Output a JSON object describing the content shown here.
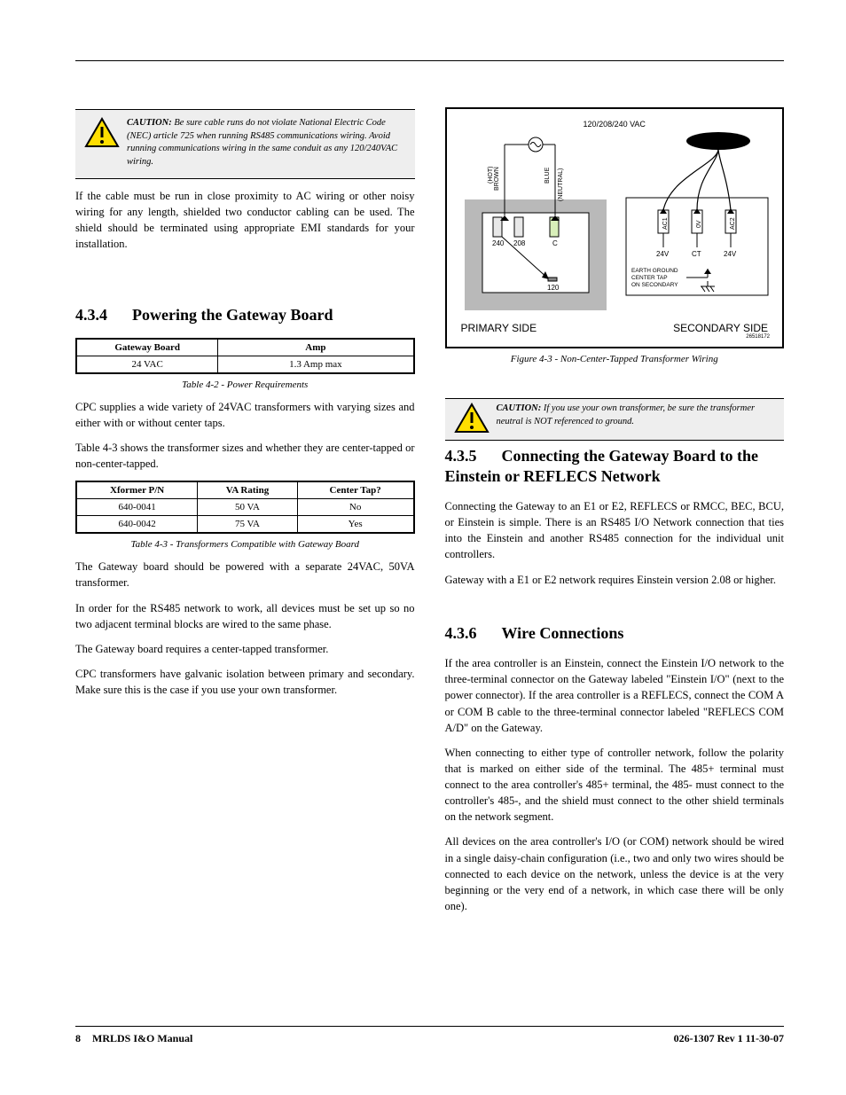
{
  "caution_left": {
    "lead": "CAUTION:",
    "text": "Be sure cable runs do not violate National Electric Code (NEC) article 725 when running RS485 communications wiring. Avoid running communications wiring in the same conduit as any 120/240VAC wiring."
  },
  "p_left_1": "If the cable must be run in close proximity to AC wiring or other noisy wiring for any length, shielded two conductor cabling can be used. The shield should be terminated using appropriate EMI standards for your installation.",
  "h_434": {
    "num": "4.3.4",
    "title": "Powering the Gateway Board"
  },
  "table42": {
    "headers": [
      "Gateway Board",
      "Amp"
    ],
    "rows": [
      [
        "24 VAC",
        "1.3 Amp max"
      ]
    ],
    "caption": "Table 4-2 - Power Requirements"
  },
  "p_left_2": "CPC supplies a wide variety of 24VAC transformers with varying sizes and either with or without center taps.",
  "p_left_3": "Table 4-3 shows the transformer sizes and whether they are center-tapped or non-center-tapped.",
  "table43": {
    "headers": [
      "Xformer P/N",
      "VA Rating",
      "Center Tap?"
    ],
    "rows": [
      [
        "640-0041",
        "50 VA",
        "No"
      ],
      [
        "640-0042",
        "75 VA",
        "Yes"
      ]
    ],
    "caption": "Table 4-3 - Transformers Compatible with Gateway Board"
  },
  "p_left_4": "The Gateway board should be powered with a separate 24VAC, 50VA transformer.",
  "p_left_5": "In order for the RS485 network to work, all devices must be set up so no two adjacent terminal blocks are wired to the same phase.",
  "p_left_6": "The Gateway board requires a center-tapped transformer.",
  "p_left_7": "CPC transformers have galvanic isolation between primary and secondary. Make sure this is the case if you use your own transformer.",
  "fig43": {
    "top_label": "120/208/240 VAC",
    "primary_wires": {
      "brown": "BROWN\n(HOT)",
      "blue": "BLUE\n(NEUTRAL)"
    },
    "primary_terms": [
      "240",
      "208",
      "C",
      "120"
    ],
    "secondary_terms": [
      "AC1",
      "0V",
      "AC2"
    ],
    "secondary_bottom": [
      "24V",
      "CT",
      "24V"
    ],
    "earth_note": "EARTH GROUND\nCENTER TAP\nON SECONDARY",
    "left_caption": "PRIMARY SIDE",
    "right_caption": "SECONDARY SIDE",
    "partno": "26518172",
    "caption": "Figure 4-3  - Non-Center-Tapped Transformer Wiring"
  },
  "caution_right": {
    "lead": "CAUTION:",
    "text": "If you use your own transformer, be sure the transformer neutral is NOT referenced to ground."
  },
  "h_435": {
    "num": "4.3.5",
    "title": "Connecting the Gateway Board to the Einstein or REFLECS Network"
  },
  "p_right_1": "Connecting the Gateway to an E1 or E2, REFLECS or RMCC, BEC, BCU, or Einstein is simple. There is an RS485 I/O Network connection that ties into the Einstein and another RS485 connection for the individual unit controllers.",
  "p_right_2": "Gateway with a E1 or E2 network requires Einstein version 2.08 or higher.",
  "h_436": {
    "num": "4.3.6",
    "title": "Wire Connections"
  },
  "p_right_3": "If the area controller is an Einstein, connect the Einstein I/O network to the three-terminal connector on the Gateway labeled \"Einstein I/O\" (next to the power connector). If the area controller is a REFLECS, connect the COM A or COM B cable to the three-terminal connector labeled \"REFLECS COM A/D\" on the Gateway.",
  "p_right_4": "When connecting to either type of controller network, follow the polarity that is marked on either side of the terminal. The 485+ terminal must connect to the area controller's 485+ terminal, the 485- must connect to the controller's 485-, and the shield must connect to the other shield terminals on the network segment.",
  "p_right_5": "All devices on the area controller's I/O (or COM) network should be wired in a single daisy-chain configuration (i.e., two and only two wires should be connected to each device on the network, unless the device is at the very beginning or the very end of a network, in which case there will be only one).",
  "footer": {
    "page": "8",
    "left": "MRLDS I&O Manual",
    "right": "026-1307 Rev 1 11-30-07"
  }
}
